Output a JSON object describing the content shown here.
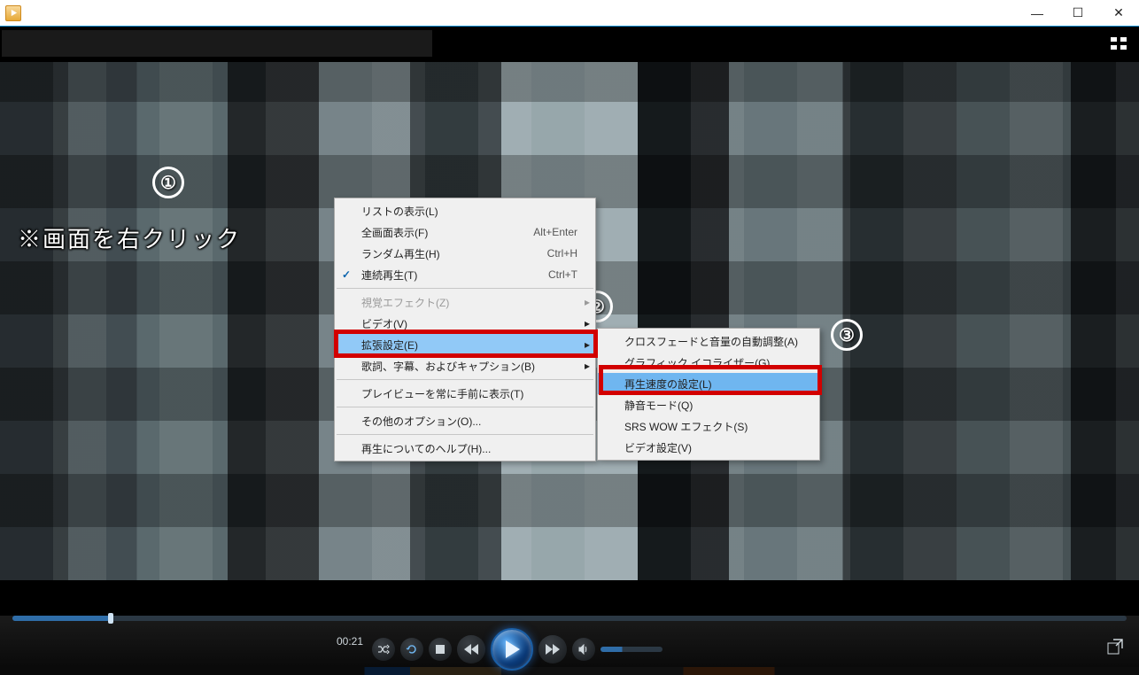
{
  "window": {
    "title": ""
  },
  "annotation": {
    "step1": "①",
    "step2": "②",
    "step3": "③",
    "text": "※画面を右クリック"
  },
  "menu1": {
    "showList": {
      "label": "リストの表示(L)"
    },
    "fullScreen": {
      "label": "全画面表示(F)",
      "shortcut": "Alt+Enter"
    },
    "shuffle": {
      "label": "ランダム再生(H)",
      "shortcut": "Ctrl+H"
    },
    "repeat": {
      "label": "連続再生(T)",
      "shortcut": "Ctrl+T"
    },
    "visualEffect": {
      "label": "視覚エフェクト(Z)"
    },
    "video": {
      "label": "ビデオ(V)"
    },
    "advanced": {
      "label": "拡張設定(E)"
    },
    "captions": {
      "label": "歌詞、字幕、およびキャプション(B)"
    },
    "alwaysOnTop": {
      "label": "プレイビューを常に手前に表示(T)"
    },
    "otherOptions": {
      "label": "その他のオプション(O)..."
    },
    "helpPlayback": {
      "label": "再生についてのヘルプ(H)..."
    }
  },
  "menu2": {
    "crossfade": {
      "label": "クロスフェードと音量の自動調整(A)"
    },
    "equalizer": {
      "label": "グラフィック イコライザー(G)"
    },
    "playSpeed": {
      "label": "再生速度の設定(L)"
    },
    "quietMode": {
      "label": "静音モード(Q)"
    },
    "srs": {
      "label": "SRS WOW エフェクト(S)"
    },
    "videoSettings": {
      "label": "ビデオ設定(V)"
    }
  },
  "controls": {
    "time": "00:21"
  }
}
